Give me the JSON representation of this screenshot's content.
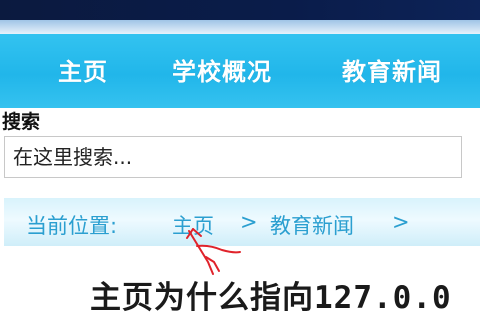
{
  "nav": {
    "items": [
      {
        "label": "主页"
      },
      {
        "label": "学校概况"
      },
      {
        "label": "教育新闻"
      }
    ]
  },
  "search": {
    "label": "搜索",
    "placeholder": "在这里搜索..."
  },
  "breadcrumb": {
    "prefix": "当前位置:",
    "items": [
      {
        "label": "主页"
      },
      {
        "label": "教育新闻"
      }
    ],
    "separator": ">"
  },
  "article": {
    "title": "主页为什么指向127.0.0"
  },
  "colors": {
    "nav_bg": "#21b6ea",
    "nav_text": "#ffffff",
    "breadcrumb_text": "#2b9fd0",
    "annotation": "#e0232b"
  },
  "annotation": {
    "icon": "red-arrow-annotation-icon"
  }
}
